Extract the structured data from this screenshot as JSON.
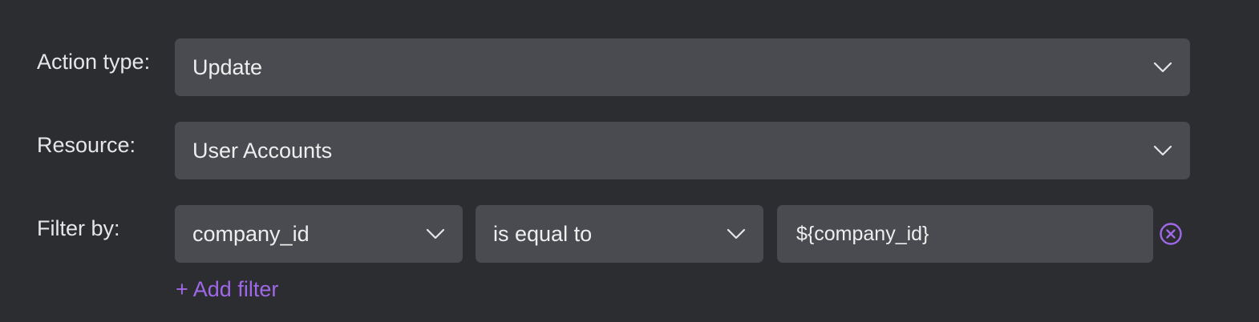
{
  "form": {
    "action_type": {
      "label": "Action type:",
      "value": "Update",
      "icon": "chevron-down-icon"
    },
    "resource": {
      "label": "Resource:",
      "value": "User Accounts",
      "icon": "chevron-down-icon"
    },
    "filter": {
      "label": "Filter by:",
      "field": "company_id",
      "operator": "is equal to",
      "value": "${company_id}",
      "remove_icon": "close-circle-icon",
      "add_label": "+ Add filter"
    }
  },
  "colors": {
    "background": "#2c2d31",
    "field_bg": "#4a4b50",
    "text": "#eeeeef",
    "accent": "#9f68e6"
  }
}
